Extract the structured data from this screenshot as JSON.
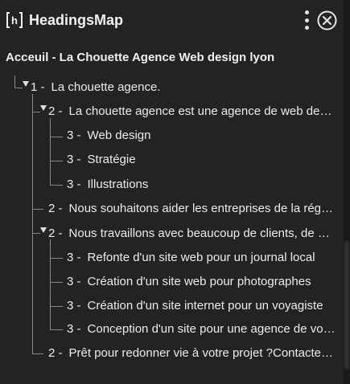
{
  "header": {
    "app_name": "HeadingsMap",
    "logo_text": "h"
  },
  "document": {
    "title": "Acceuil - La Chouette Agence Web design lyon"
  },
  "headings": [
    {
      "level": "1 -",
      "text": "La chouette agence."
    },
    {
      "level": "2 -",
      "text": "La chouette agence est une agence de web design à Lyon"
    },
    {
      "level": "3 -",
      "text": "Web design"
    },
    {
      "level": "3 -",
      "text": "Stratégie"
    },
    {
      "level": "3 -",
      "text": "Illustrations"
    },
    {
      "level": "2 -",
      "text": "Nous souhaitons aider les entreprises de la région lyonnaise"
    },
    {
      "level": "2 -",
      "text": "Nous travaillons avec beaucoup de clients, de tous horizons"
    },
    {
      "level": "3 -",
      "text": "Refonte d'un site web pour un journal local"
    },
    {
      "level": "3 -",
      "text": "Création d'un site web pour photographes"
    },
    {
      "level": "3 -",
      "text": "Création d'un site internet pour un voyagiste"
    },
    {
      "level": "3 -",
      "text": "Conception d'un site pour une agence de voyage"
    },
    {
      "level": "2 -",
      "text": "Prêt pour redonner vie à votre projet ?Contactez-nous"
    }
  ],
  "colors": {
    "background": "#232323",
    "text": "#ececec",
    "tree_lines": "#8a8a8a"
  }
}
